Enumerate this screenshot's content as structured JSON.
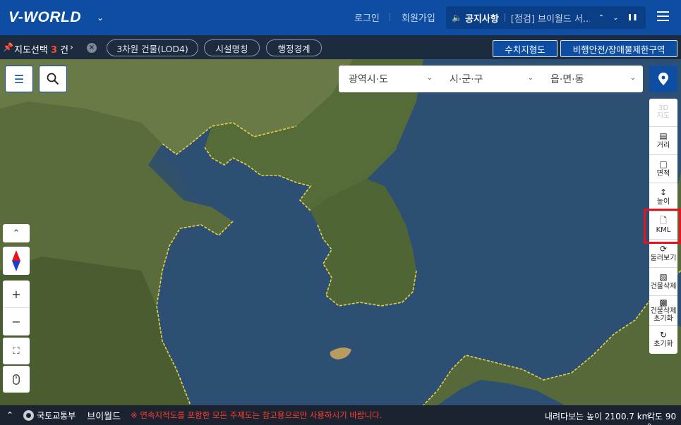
{
  "header": {
    "logo": "V-WORLD",
    "login": "로그인",
    "signup": "회원가입",
    "notice_title": "공지사항",
    "notice_text": "[점검] 브이월드 서..."
  },
  "subbar": {
    "select_label": "지도선택",
    "select_count": "3",
    "select_unit": "건",
    "chips": [
      "3차원 건물(LOD4)",
      "시설명칭",
      "행정경계"
    ],
    "btn_contour": "수치지형도",
    "btn_flight": "비행안전/장애물제한구역"
  },
  "address": {
    "province": "광역시·도",
    "city": "시·군·구",
    "town": "읍·면·동"
  },
  "tools": {
    "t3d": "3D 지도",
    "distance": "거리",
    "area": "면적",
    "height": "높이",
    "kml": "KML",
    "look": "둘러보기",
    "bldg_delete": "건물삭제",
    "bldg_reset_1": "건물삭제",
    "bldg_reset_2": "초기화",
    "reset": "초기화"
  },
  "footer": {
    "ministry": "국토교통부",
    "brand": "브이월드",
    "warning": "※ 연속지적도를 포함한 모든 주제도는 참고용으로만 사용하시기 바랍니다.",
    "altitude": "내려다보는 높이 2100.7 km",
    "angle": "각도 90 °"
  },
  "colors": {
    "header_bg": "#0d4ea3",
    "subbar_bg": "#1c2b3f",
    "highlight": "#e8141d",
    "border_line": "#e6d24a"
  }
}
